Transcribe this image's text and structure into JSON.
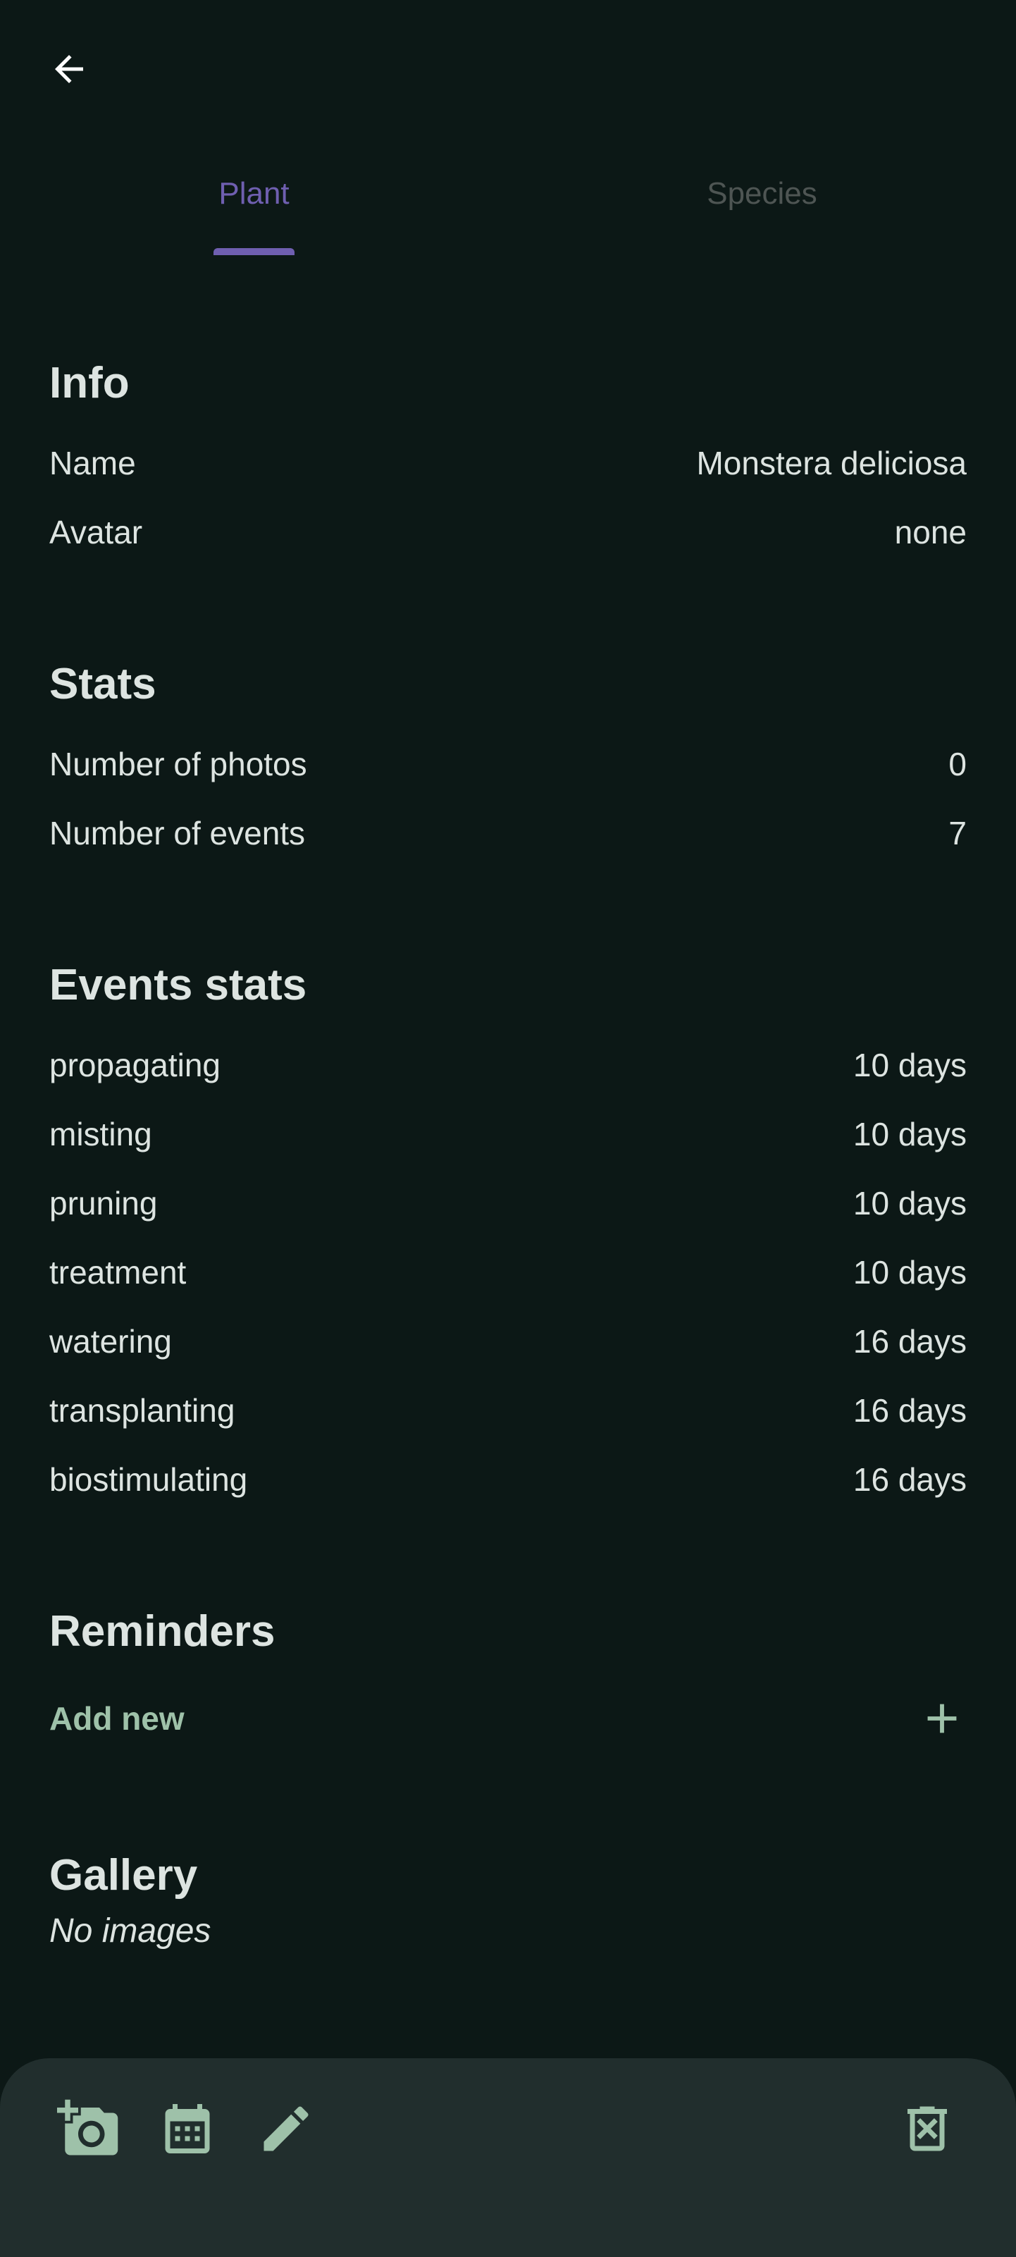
{
  "tabs": [
    {
      "label": "Plant"
    },
    {
      "label": "Species"
    }
  ],
  "info": {
    "title": "Info",
    "rows": [
      {
        "label": "Name",
        "value": "Monstera deliciosa"
      },
      {
        "label": "Avatar",
        "value": "none"
      }
    ]
  },
  "stats": {
    "title": "Stats",
    "rows": [
      {
        "label": "Number of photos",
        "value": "0"
      },
      {
        "label": "Number of events",
        "value": "7"
      }
    ]
  },
  "events_stats": {
    "title": "Events stats",
    "rows": [
      {
        "label": "propagating",
        "value": "10 days"
      },
      {
        "label": "misting",
        "value": "10 days"
      },
      {
        "label": "pruning",
        "value": "10 days"
      },
      {
        "label": "treatment",
        "value": "10 days"
      },
      {
        "label": "watering",
        "value": "16 days"
      },
      {
        "label": "transplanting",
        "value": "16 days"
      },
      {
        "label": "biostimulating",
        "value": "16 days"
      }
    ]
  },
  "reminders": {
    "title": "Reminders",
    "add_label": "Add new"
  },
  "gallery": {
    "title": "Gallery",
    "empty_text": "No images"
  },
  "icons": {
    "back": "arrow-back-icon",
    "add_reminder": "plus-icon",
    "add_photo": "add-photo-icon",
    "calendar": "calendar-icon",
    "edit": "pencil-icon",
    "delete": "delete-icon"
  },
  "colors": {
    "background": "#0c1816",
    "accent": "#6f5fb0",
    "action_green": "#9ec1a9",
    "bottom_bar": "#212e2d"
  }
}
